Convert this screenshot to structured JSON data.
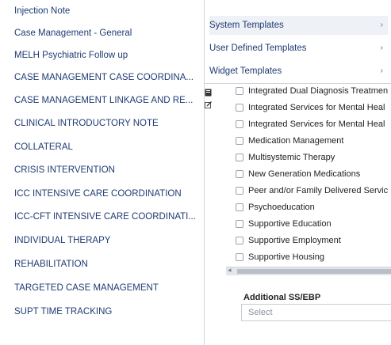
{
  "templates": [
    "Injection Note",
    "Case Management - General",
    "MELH Psychiatric Follow up",
    "CASE MANAGEMENT CASE COORDINA...",
    "CASE MANAGEMENT LINKAGE AND RE...",
    "CLINICAL INTRODUCTORY NOTE",
    "COLLATERAL",
    "CRISIS INTERVENTION",
    "ICC INTENSIVE CARE COORDINATION",
    "ICC-CFT INTENSIVE CARE COORDINATI...",
    "INDIVIDUAL THERAPY",
    "REHABILITATION",
    "TARGETED CASE MANAGEMENT",
    "SUPT TIME TRACKING"
  ],
  "submenu": [
    {
      "label": "System Templates",
      "highlight": true
    },
    {
      "label": "User Defined Templates",
      "highlight": false
    },
    {
      "label": "Widget Templates",
      "highlight": false
    }
  ],
  "checklist": [
    "Integrated Dual Diagnosis Treatmen",
    "Integrated Services for Mental Heal",
    "Integrated Services for Mental Heal",
    "Medication Management",
    "Multisystemic Therapy",
    "New Generation Medications",
    "Peer and/or Family Delivered Servic",
    "Psychoeducation",
    "Supportive Education",
    "Supportive Employment",
    "Supportive Housing"
  ],
  "additional": {
    "label": "Additional SS/EBP",
    "placeholder": "Select"
  },
  "colors": {
    "link": "#1f3b73",
    "highlight": "#eef1f5"
  },
  "icons": {
    "submenu_caret": "chevron-right-icon",
    "doc": "document-icon",
    "edit": "edit-icon"
  }
}
